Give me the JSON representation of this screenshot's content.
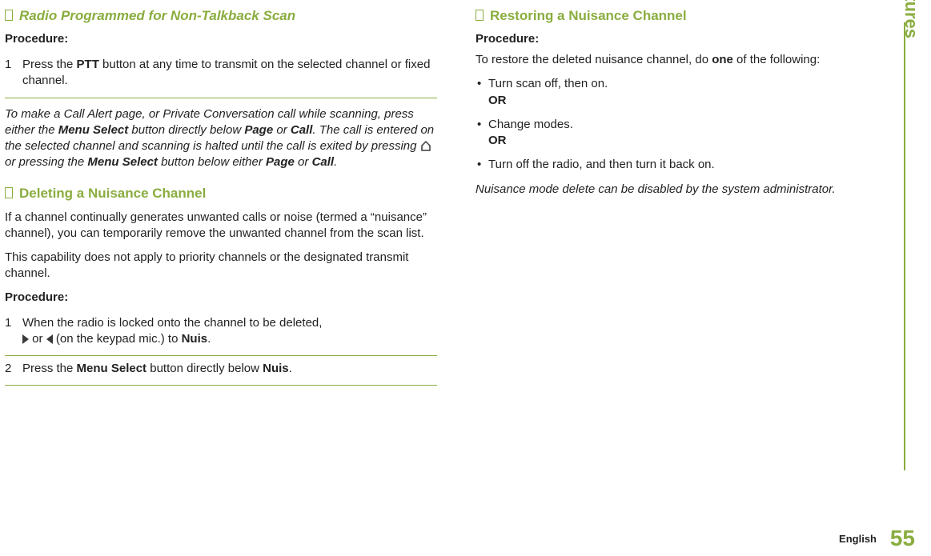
{
  "sidebar": {
    "label": "Advanced Features"
  },
  "footer": {
    "language": "English",
    "page_number": "55"
  },
  "left": {
    "section1_title": "Radio Programmed for Non-Talkback Scan",
    "procedure_label": "Procedure:",
    "step1_num": "1",
    "step1_a": "Press the ",
    "step1_ptt": "PTT",
    "step1_b": " button at any time to transmit on the selected channel or fixed channel.",
    "note_a": "To make a Call Alert page, or Private Conversation call while scanning, press either the ",
    "menu_select": "Menu Select",
    "note_b": " button directly below ",
    "page_word": "Page",
    "note_or": " or ",
    "call_word": "Call",
    "note_c": ". The call is entered on the selected channel and scanning is halted until the call is exited by pressing ",
    "note_d": " or pressing the ",
    "note_e": " button below either ",
    "note_f": ".",
    "section2_title": "Deleting a Nuisance Channel",
    "del_para1": "If a channel continually generates unwanted calls or noise (termed a “nuisance” channel), you can temporarily remove the unwanted channel from the scan list.",
    "del_para2": "This capability does not apply to priority channels or the designated transmit channel.",
    "del_step1_num": "1",
    "del_step1_a": "When the radio is locked onto the channel to be deleted, ",
    "del_step1_b": " or ",
    "del_step1_c": " (on the keypad mic.) to ",
    "nuis_word": "Nuis",
    "del_step1_d": ".",
    "del_step2_num": "2",
    "del_step2_a": "Press the ",
    "del_step2_b": " button directly below ",
    "del_step2_c": "."
  },
  "right": {
    "section_title": "Restoring a Nuisance Channel",
    "procedure_label": "Procedure:",
    "intro_a": "To restore the deleted nuisance channel, do ",
    "intro_one": "one",
    "intro_b": " of the following:",
    "b1_a": "Turn scan off, then on.",
    "or": "OR",
    "b2_a": "Change modes.",
    "b3_a": "Turn off the radio, and then turn it back on.",
    "note": "Nuisance mode delete can be disabled by the system administrator."
  }
}
